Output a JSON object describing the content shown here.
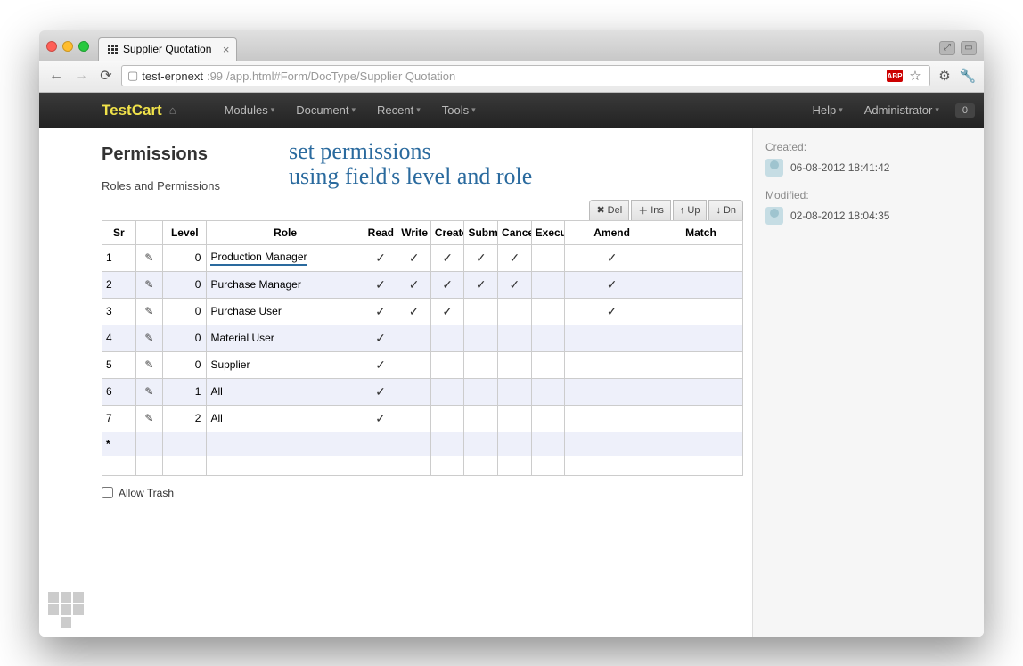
{
  "browser": {
    "tab_title": "Supplier Quotation",
    "url_host": "test-erpnext",
    "url_port": ":99",
    "url_path": "/app.html#Form/DocType/Supplier Quotation",
    "extensions": {
      "abp": "ABP"
    }
  },
  "navbar": {
    "brand": "TestCart",
    "links": [
      "Modules",
      "Document",
      "Recent",
      "Tools"
    ],
    "right_links": [
      "Help",
      "Administrator"
    ],
    "badge": "0"
  },
  "sidebar": {
    "created_label": "Created:",
    "created_value": "06-08-2012 18:41:42",
    "modified_label": "Modified:",
    "modified_value": "02-08-2012 18:04:35"
  },
  "section": {
    "title": "Permissions",
    "subtitle": "Roles and Permissions",
    "annotation_line1": "set permissions",
    "annotation_line2": "using field's level and role"
  },
  "grid_toolbar": {
    "del": "Del",
    "ins": "Ins",
    "up": "Up",
    "dn": "Dn"
  },
  "columns": {
    "sr": "Sr",
    "level": "Level",
    "role": "Role",
    "read": "Read",
    "write": "Write",
    "create": "Create",
    "submit": "Submit",
    "cancel": "Cancel",
    "execute": "Execute",
    "amend": "Amend",
    "match": "Match"
  },
  "rows": [
    {
      "sr": "1",
      "level": "0",
      "role": "Production Manager",
      "read": true,
      "write": true,
      "create": true,
      "submit": true,
      "cancel": true,
      "execute": false,
      "amend": true,
      "match": "",
      "highlight_role": true
    },
    {
      "sr": "2",
      "level": "0",
      "role": "Purchase Manager",
      "read": true,
      "write": true,
      "create": true,
      "submit": true,
      "cancel": true,
      "execute": false,
      "amend": true,
      "match": ""
    },
    {
      "sr": "3",
      "level": "0",
      "role": "Purchase User",
      "read": true,
      "write": true,
      "create": true,
      "submit": false,
      "cancel": false,
      "execute": false,
      "amend": true,
      "match": ""
    },
    {
      "sr": "4",
      "level": "0",
      "role": "Material User",
      "read": true,
      "write": false,
      "create": false,
      "submit": false,
      "cancel": false,
      "execute": false,
      "amend": false,
      "match": ""
    },
    {
      "sr": "5",
      "level": "0",
      "role": "Supplier",
      "read": true,
      "write": false,
      "create": false,
      "submit": false,
      "cancel": false,
      "execute": false,
      "amend": false,
      "match": ""
    },
    {
      "sr": "6",
      "level": "1",
      "role": "All",
      "read": true,
      "write": false,
      "create": false,
      "submit": false,
      "cancel": false,
      "execute": false,
      "amend": false,
      "match": ""
    },
    {
      "sr": "7",
      "level": "2",
      "role": "All",
      "read": true,
      "write": false,
      "create": false,
      "submit": false,
      "cancel": false,
      "execute": false,
      "amend": false,
      "match": ""
    }
  ],
  "new_row_marker": "*",
  "allow_trash_label": "Allow Trash",
  "allow_trash_checked": false
}
